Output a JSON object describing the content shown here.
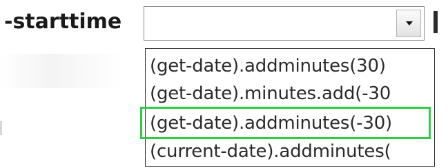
{
  "parameter": {
    "label": "-starttime"
  },
  "combo": {
    "value": "",
    "dropdown_icon": "chevron-down-icon"
  },
  "dropdown": {
    "options": [
      "(get-date).addminutes(30)",
      "(get-date).minutes.add(-30",
      "(get-date).addminutes(-30)",
      "(current-date).addminutes("
    ],
    "highlighted_index": 2
  },
  "colors": {
    "highlight_border": "#2ecc40",
    "text": "#1a1a1a",
    "list_border": "#333333"
  }
}
